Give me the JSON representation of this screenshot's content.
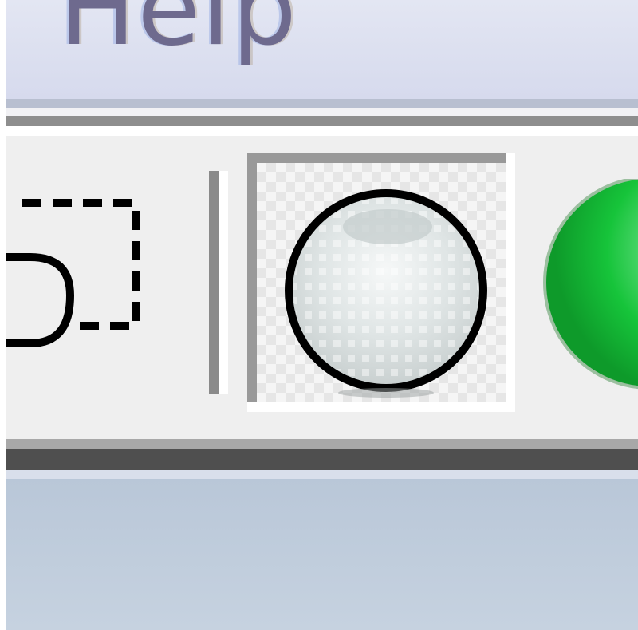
{
  "menubar": {
    "items": [
      {
        "label": "Help"
      }
    ]
  },
  "toolbar": {
    "tools": [
      {
        "icon": "shape-select-icon",
        "state": "normal"
      },
      {
        "icon": "gray-sphere-icon",
        "state": "pressed"
      },
      {
        "icon": "green-sphere-icon",
        "state": "normal"
      }
    ]
  },
  "colors": {
    "menubar_bg": "#d9ddef",
    "menu_text": "#6e6a8e",
    "toolbar_bg": "#efefef",
    "status_bg": "#bdcadb",
    "green_accent": "#16c43a"
  }
}
